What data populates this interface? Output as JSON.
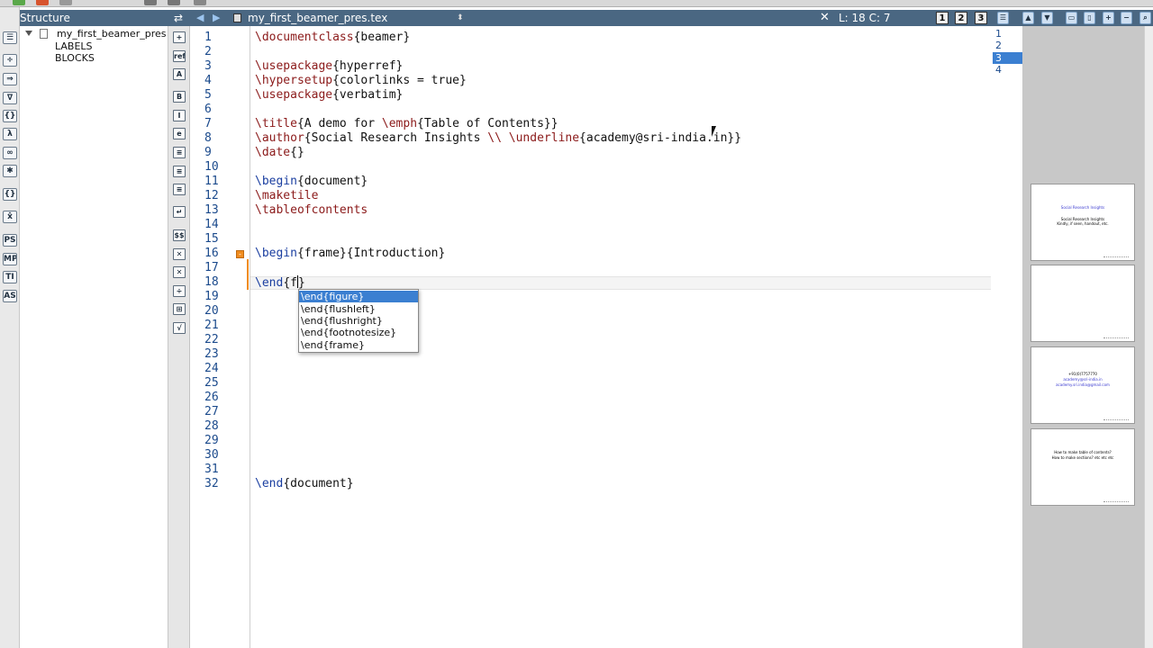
{
  "structure": {
    "header": "Structure",
    "root": "my_first_beamer_pres",
    "children": [
      "LABELS",
      "BLOCKS"
    ]
  },
  "tab": {
    "filename": "my_first_beamer_pres.tex",
    "position": "L: 18 C: 7",
    "view1": "1",
    "view2": "2",
    "view3": "3"
  },
  "left_toolbar_icons": [
    "list-icon",
    "fraction-icon",
    "arrows-icon",
    "nabla-icon",
    "braces-icon",
    "lambda-icon",
    "infinity-icon",
    "asterisk-icon",
    "bracket-icon",
    "delimiter-icon",
    "ps-icon",
    "mp-icon",
    "ti-icon",
    "as-icon"
  ],
  "left_toolbar_labels": [
    "",
    "",
    "",
    "∇",
    "{}",
    "λ",
    "∞",
    "✱",
    "{}",
    "x̂",
    "PS",
    "MP",
    "TI",
    "AS"
  ],
  "editor_icon_labels": [
    "+",
    "ref",
    "A",
    "B",
    "I",
    "e",
    "",
    "",
    "",
    "↵",
    "$$",
    "✕",
    "✕",
    "÷",
    "⊞",
    "√"
  ],
  "editor_icon_names": [
    "add-icon",
    "ref-icon",
    "text-size-icon",
    "bold-icon",
    "italic-icon",
    "emph-icon",
    "align-left-icon",
    "align-center-icon",
    "align-right-icon",
    "newline-icon",
    "math-icon",
    "subscript-icon",
    "superscript-icon",
    "frac-icon",
    "matrix-icon",
    "sqrt-icon"
  ],
  "line_numbers": [
    "1",
    "2",
    "3",
    "4",
    "5",
    "6",
    "7",
    "8",
    "9",
    "10",
    "11",
    "12",
    "13",
    "14",
    "15",
    "16",
    "17",
    "18",
    "19",
    "20",
    "21",
    "22",
    "23",
    "24",
    "25",
    "26",
    "27",
    "28",
    "29",
    "30",
    "31",
    "32"
  ],
  "code": {
    "l1_cmd": "\\documentclass",
    "l1_arg": "{beamer}",
    "l3_cmd": "\\usepackage",
    "l3_arg": "{hyperref}",
    "l4_cmd": "\\hypersetup",
    "l4_arg": "{colorlinks = true}",
    "l5_cmd": "\\usepackage",
    "l5_arg": "{verbatim}",
    "l7_cmd": "\\title",
    "l7_a": "{A demo for ",
    "l7_cmd2": "\\emph",
    "l7_b": "{Table of Contents}}",
    "l8_cmd": "\\author",
    "l8_a": "{Social Research Insights ",
    "l8_cmd2": "\\\\ \\underline",
    "l8_b": "{academy@sri-india.in}}",
    "l9_cmd": "\\date",
    "l9_arg": "{}",
    "l11_cmd": "\\begin",
    "l11_arg": "{document}",
    "l12_cmd": "\\maketile",
    "l13_cmd": "\\tableofcontents",
    "l16_cmd": "\\begin",
    "l16_arg": "{frame}{Introduction}",
    "l18_cmd": "\\end",
    "l18_a": "{f",
    "l18_b": "}",
    "l32_cmd": "\\end",
    "l32_arg": "{document}"
  },
  "autocomplete": {
    "items": [
      "\\end{figure}",
      "\\end{flushleft}",
      "\\end{flushright}",
      "\\end{footnotesize}",
      "\\end{frame}"
    ]
  },
  "pages": [
    "1",
    "2",
    "3",
    "4"
  ],
  "slides": {
    "s1_title": "Social Research Insights",
    "s1_sub1": "Social Research Insights",
    "s1_sub2": "Kindly, if seen, handout, etc.",
    "s3_l1": "+91(0)7757770",
    "s3_l2": "academy@sri-india.in",
    "s3_l3": "academy.sri.india@gmail.com",
    "s4_l1": "How to make table of contents?",
    "s4_l2": "How to make sections? etc etc etc"
  },
  "colors": {
    "header_bg": "#4a6782",
    "keyword": "#1a3ea0",
    "command": "#8b1a1a",
    "selection": "#3b7fd1",
    "fold_marker": "#f08c1e"
  }
}
